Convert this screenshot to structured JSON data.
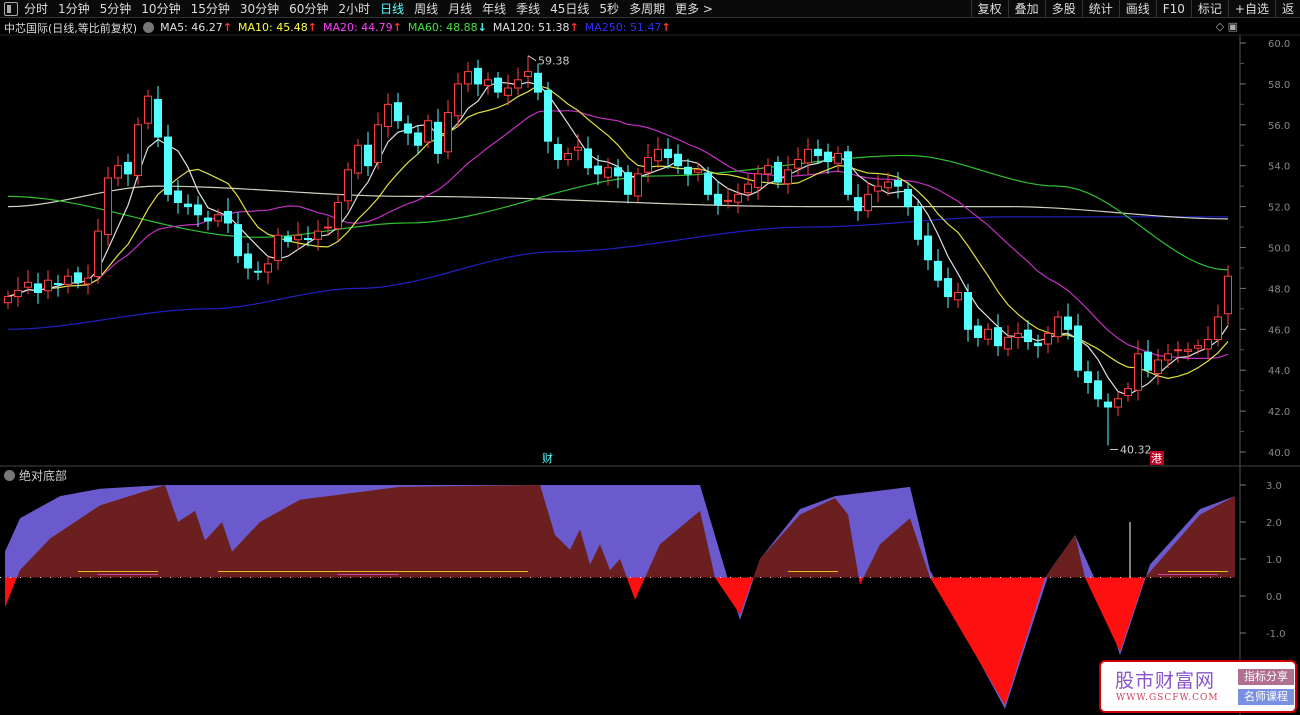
{
  "toolbar": {
    "periods": [
      "分时",
      "1分钟",
      "5分钟",
      "10分钟",
      "15分钟",
      "30分钟",
      "60分钟",
      "2小时",
      "日线",
      "周线",
      "月线",
      "年线",
      "季线",
      "45日线",
      "5秒",
      "多周期",
      "更多 >"
    ],
    "active_period": "日线",
    "right_buttons": [
      "复权",
      "叠加",
      "多股",
      "统计",
      "画线",
      "F10",
      "标记",
      "+自选",
      "返"
    ]
  },
  "legend": {
    "title": "中芯国际(日线,等比前复权)",
    "items": [
      {
        "label": "MA5: 46.27",
        "arrow": "↑",
        "color": "#e0e0e0"
      },
      {
        "label": "MA10: 45.48",
        "arrow": "↑",
        "color": "#ffff40"
      },
      {
        "label": "MA20: 44.79",
        "arrow": "↑",
        "color": "#ff40ff"
      },
      {
        "label": "MA60: 48.88",
        "arrow": "↓",
        "color": "#40e040"
      },
      {
        "label": "MA120: 51.38",
        "arrow": "↑",
        "color": "#e0e0e0"
      },
      {
        "label": "MA250: 51.47",
        "arrow": "↑",
        "color": "#3030ff"
      }
    ]
  },
  "indicator": {
    "title": "绝对底部"
  },
  "annotations": {
    "high": "59.38",
    "low": "40.32",
    "cai": "财",
    "gang": "港"
  },
  "watermark": {
    "name": "股市财富网",
    "url": "WWW.GSCFW.COM",
    "tag1": "指标分享",
    "tag2": "名师课程"
  },
  "chart_data": [
    {
      "type": "candlestick",
      "y_ticks": [
        "60.0",
        "58.0",
        "56.0",
        "54.0",
        "52.0",
        "50.0",
        "48.0",
        "46.0",
        "44.0",
        "42.0",
        "40.0"
      ],
      "ylim": [
        40,
        60
      ],
      "high_mark": 59.38,
      "low_mark": 40.32,
      "closes": [
        47.6,
        47.9,
        48.3,
        47.8,
        48.4,
        48.2,
        48.6,
        48.3,
        48.5,
        50.8,
        53.4,
        54.0,
        53.6,
        56.0,
        57.4,
        55.4,
        52.6,
        52.2,
        52.0,
        51.6,
        51.3,
        51.6,
        51.2,
        49.6,
        49.0,
        48.8,
        49.2,
        50.6,
        50.3,
        50.6,
        50.4,
        50.8,
        51.0,
        52.2,
        53.8,
        55.0,
        54.0,
        56.0,
        57.0,
        56.2,
        55.6,
        55.0,
        56.2,
        54.6,
        56.6,
        58.0,
        58.6,
        58.0,
        58.2,
        57.6,
        57.8,
        58.2,
        58.6,
        57.6,
        55.2,
        54.3,
        54.6,
        54.9,
        53.9,
        53.6,
        53.9,
        53.5,
        52.6,
        53.6,
        54.4,
        54.8,
        54.4,
        54.0,
        53.6,
        53.8,
        52.6,
        52.1,
        52.3,
        52.6,
        53.1,
        53.6,
        54.0,
        53.2,
        53.8,
        54.3,
        54.8,
        54.5,
        54.2,
        54.6,
        52.6,
        51.8,
        52.6,
        53.0,
        53.2,
        53.0,
        52.0,
        50.4,
        49.4,
        48.4,
        47.6,
        47.8,
        46.0,
        45.6,
        46.0,
        45.2,
        45.6,
        45.8,
        45.4,
        45.2,
        45.8,
        46.6,
        46.0,
        44.0,
        43.4,
        42.6,
        42.2,
        42.6,
        43.1,
        44.8,
        44.0,
        44.5,
        44.8,
        45.0,
        45.0,
        45.2,
        45.5,
        46.6,
        48.6
      ],
      "ma60": [
        [
          0,
          52.5
        ],
        [
          25,
          50.5
        ],
        [
          40,
          51.2
        ],
        [
          65,
          53.5
        ],
        [
          90,
          54.5
        ],
        [
          105,
          53.0
        ],
        [
          122,
          48.9
        ]
      ],
      "ma120": [
        [
          0,
          52.0
        ],
        [
          15,
          53.0
        ],
        [
          40,
          52.5
        ],
        [
          80,
          52.0
        ],
        [
          100,
          52.0
        ],
        [
          122,
          51.4
        ]
      ],
      "ma250": [
        [
          0,
          46.0
        ],
        [
          20,
          47.0
        ],
        [
          35,
          48.0
        ],
        [
          55,
          49.8
        ],
        [
          80,
          51.0
        ],
        [
          100,
          51.5
        ],
        [
          122,
          51.5
        ]
      ]
    },
    {
      "type": "area",
      "title": "绝对底部",
      "y_ticks": [
        "3.0",
        "2.0",
        "1.0",
        "0.0",
        "-1.0"
      ],
      "ylim": [
        -3.2,
        3.2
      ],
      "baseline": 0.5,
      "upper": [
        [
          -0.3,
          1.2
        ],
        [
          1.2,
          2.1
        ],
        [
          5.2,
          2.7
        ],
        [
          9.2,
          2.9
        ],
        [
          15.7,
          3.0
        ],
        [
          69.2,
          3.0
        ],
        [
          73.2,
          -0.65
        ],
        [
          75.2,
          1.0
        ],
        [
          79.2,
          2.35
        ],
        [
          82.7,
          2.7
        ],
        [
          90.2,
          2.95
        ],
        [
          92.2,
          0.7
        ],
        [
          99.7,
          -3.05
        ],
        [
          104.2,
          0.7
        ],
        [
          106.7,
          1.65
        ],
        [
          109.2,
          0.15
        ],
        [
          111.2,
          -1.6
        ],
        [
          114.2,
          0.85
        ],
        [
          119.2,
          2.35
        ],
        [
          122.7,
          2.7
        ]
      ],
      "lower": [
        [
          -0.3,
          -0.3
        ],
        [
          1.2,
          0.7
        ],
        [
          4.2,
          1.55
        ],
        [
          9.2,
          2.45
        ],
        [
          15.7,
          3.0
        ],
        [
          17.0,
          2.0
        ],
        [
          18.7,
          2.3
        ],
        [
          19.7,
          1.5
        ],
        [
          21.4,
          2.0
        ],
        [
          22.4,
          1.2
        ],
        [
          25.2,
          2.0
        ],
        [
          29.2,
          2.6
        ],
        [
          39.2,
          2.95
        ],
        [
          53.2,
          3.0
        ],
        [
          54.7,
          1.65
        ],
        [
          56.2,
          1.25
        ],
        [
          57.2,
          1.8
        ],
        [
          58.2,
          0.85
        ],
        [
          59.2,
          1.4
        ],
        [
          60.2,
          0.7
        ],
        [
          61.2,
          1.0
        ],
        [
          62.7,
          -0.1
        ],
        [
          65.2,
          1.4
        ],
        [
          69.2,
          2.3
        ],
        [
          70.7,
          0.5
        ],
        [
          73.2,
          -0.5
        ],
        [
          75.2,
          1.0
        ],
        [
          79.2,
          2.2
        ],
        [
          82.7,
          2.65
        ],
        [
          84.0,
          2.2
        ],
        [
          85.2,
          0.3
        ],
        [
          87.2,
          1.4
        ],
        [
          90.2,
          2.1
        ],
        [
          92.2,
          0.5
        ],
        [
          99.7,
          -2.95
        ],
        [
          103.7,
          0.5
        ],
        [
          106.7,
          1.65
        ],
        [
          107.7,
          0.5
        ],
        [
          111.2,
          -1.5
        ],
        [
          113.7,
          0.5
        ],
        [
          119.2,
          2.2
        ],
        [
          122.7,
          2.7
        ]
      ],
      "spike": {
        "index": 112.2,
        "value": 2.0
      }
    }
  ]
}
